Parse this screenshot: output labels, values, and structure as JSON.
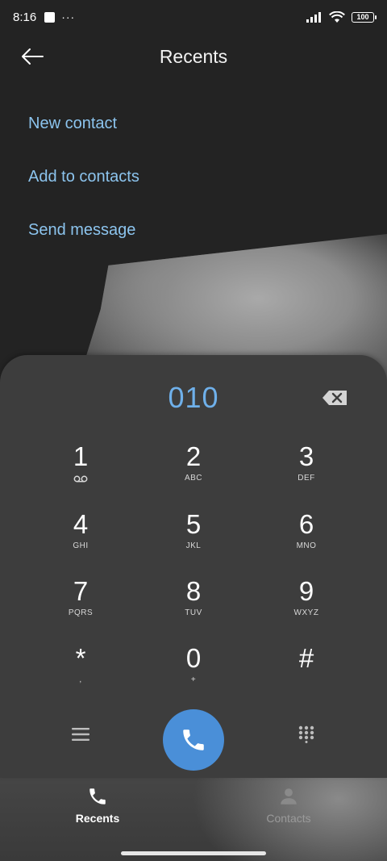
{
  "status_bar": {
    "time": "8:16",
    "more": "···",
    "battery": "100"
  },
  "header": {
    "title": "Recents",
    "back_icon": "arrow-left-icon"
  },
  "actions": [
    {
      "label": "New contact"
    },
    {
      "label": "Add to contacts"
    },
    {
      "label": "Send message"
    }
  ],
  "dialpad": {
    "number": "010",
    "keys": [
      {
        "digit": "1",
        "letters": ""
      },
      {
        "digit": "2",
        "letters": "ABC"
      },
      {
        "digit": "3",
        "letters": "DEF"
      },
      {
        "digit": "4",
        "letters": "GHI"
      },
      {
        "digit": "5",
        "letters": "JKL"
      },
      {
        "digit": "6",
        "letters": "MNO"
      },
      {
        "digit": "7",
        "letters": "PQRS"
      },
      {
        "digit": "8",
        "letters": "TUV"
      },
      {
        "digit": "9",
        "letters": "WXYZ"
      },
      {
        "digit": "*",
        "letters": ","
      },
      {
        "digit": "0",
        "letters": "+"
      },
      {
        "digit": "#",
        "letters": ""
      }
    ]
  },
  "bottom_nav": {
    "tabs": [
      {
        "label": "Recents",
        "active": true
      },
      {
        "label": "Contacts",
        "active": false
      }
    ]
  },
  "colors": {
    "accent": "#6fb0ea",
    "link": "#8cc4ee",
    "call_button": "#4a8fd8",
    "pad_background": "#3d3d3d"
  }
}
